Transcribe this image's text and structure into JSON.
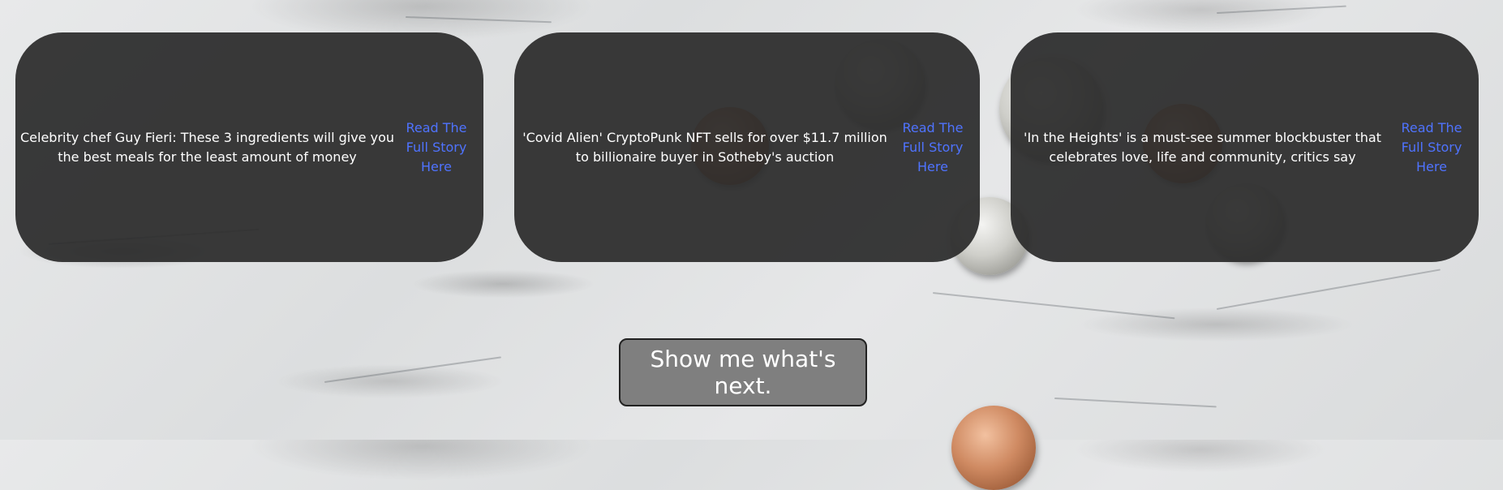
{
  "articles": [
    {
      "title": "Celebrity chef Guy Fieri: These 3 ingredients will give you the best meals for the least amount of money",
      "link_label": "Read The Full Story Here"
    },
    {
      "title": "'Covid Alien' CryptoPunk NFT sells for over $11.7 million to billionaire buyer in Sotheby's auction",
      "link_label": "Read The Full Story Here"
    },
    {
      "title": "'In the Heights' is a must-see summer blockbuster that celebrates love, life and community, critics say",
      "link_label": "Read The Full Story Here"
    }
  ],
  "next_button": {
    "label": "Show me what's next."
  },
  "colors": {
    "card_background": "#2b2b2b",
    "link": "#4f73ff",
    "button_background": "#7f7f7f",
    "button_text": "#ffffff"
  }
}
